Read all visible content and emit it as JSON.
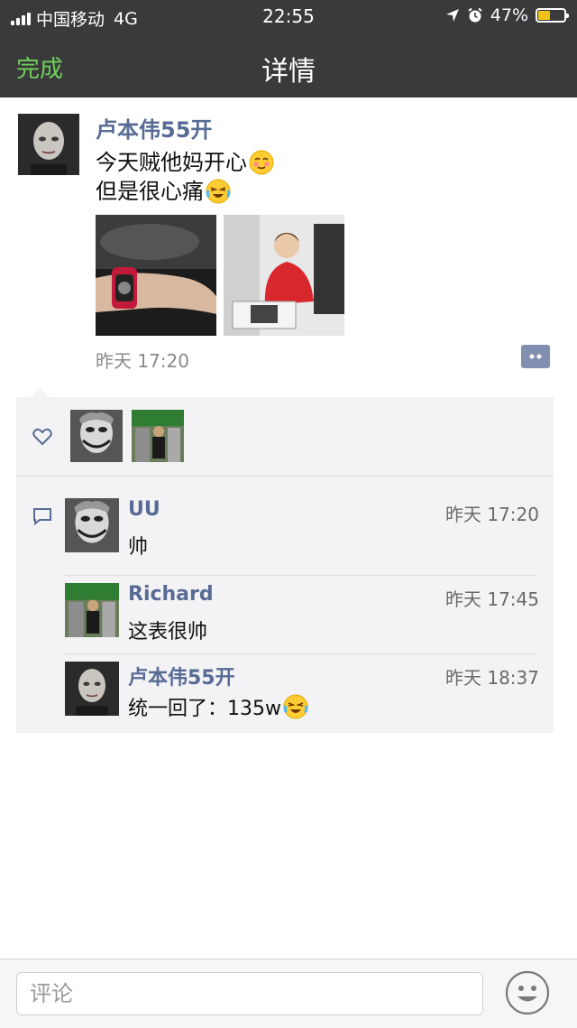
{
  "status_bar": {
    "carrier": "中国移动",
    "network": "4G",
    "time": "22:55",
    "battery": "47%",
    "battery_level": 0.47,
    "icons": [
      "signal-icon",
      "location-icon",
      "alarm-icon",
      "battery-icon"
    ]
  },
  "nav": {
    "done_label": "完成",
    "title": "详情"
  },
  "post": {
    "author": "卢本伟55开",
    "text_lines": [
      "今天贼他妈开心",
      "但是很心痛"
    ],
    "emojis": [
      "blush-emoji",
      "laugh-cry-emoji"
    ],
    "photos": [
      "watch-photo",
      "red-hoodie-photo"
    ],
    "time": "昨天 17:20",
    "more_icon": "comment-menu-icon"
  },
  "likes": {
    "icon": "heart-icon",
    "users": [
      "joker-avatar",
      "street-avatar"
    ]
  },
  "comments": [
    {
      "name": "UU",
      "time": "昨天 17:20",
      "text": "帅",
      "avatar": "joker-avatar"
    },
    {
      "name": "Richard",
      "time": "昨天 17:45",
      "text": "这表很帅",
      "avatar": "street-avatar"
    },
    {
      "name": "卢本伟55开",
      "time": "昨天 18:37",
      "text": "统一回了：135w",
      "avatar": "pale-face-avatar",
      "emoji": "laugh-cry-emoji"
    }
  ],
  "bottom": {
    "comment_placeholder": "评论",
    "emoji_button_icon": "smiley-face-icon"
  },
  "colors": {
    "bar_bg": "#3a3a3c",
    "done_green": "#6fd05a",
    "name_blue": "#576b95",
    "panel_bg": "#f3f3f5",
    "battery_yellow": "#f2c21b"
  }
}
